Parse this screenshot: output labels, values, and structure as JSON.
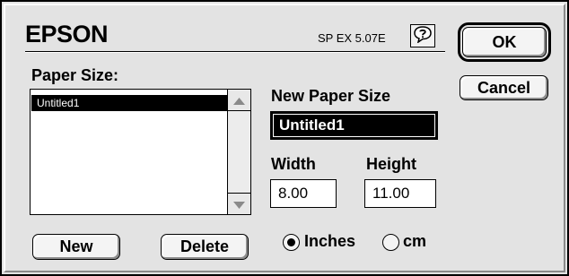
{
  "header": {
    "brand": "EPSON",
    "version": "SP EX 5.07E"
  },
  "buttons": {
    "ok": "OK",
    "cancel": "Cancel",
    "new": "New",
    "delete": "Delete"
  },
  "paper_size": {
    "label": "Paper Size:",
    "items": [
      "Untitled1"
    ],
    "selected_index": 0
  },
  "new_paper_size": {
    "label": "New Paper Size",
    "value": "Untitled1"
  },
  "dimensions": {
    "width_label": "Width",
    "width_value": "8.00",
    "height_label": "Height",
    "height_value": "11.00"
  },
  "units": {
    "options": [
      "Inches",
      "cm"
    ],
    "selected": "Inches"
  },
  "icons": {
    "help": "help-balloon-icon",
    "scroll_up": "scroll-up-arrow-icon",
    "scroll_down": "scroll-down-arrow-icon"
  }
}
